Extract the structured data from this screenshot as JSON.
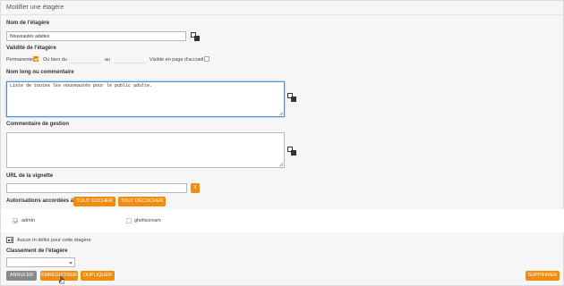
{
  "page": {
    "title": "Modifier une étagère"
  },
  "name_section": {
    "label": "Nom de l'étagère",
    "value": "Nouveautés adultes",
    "translate_icon": "translate-icon"
  },
  "validity": {
    "label": "Validité de l'étagère",
    "permanent_label": "Permanente",
    "or_from_label": "Ou bien du",
    "to_label": "au",
    "homepage_label": "Visible en page d'accueil ?"
  },
  "long_name": {
    "label": "Nom long ou commentaire",
    "value": "Liste de toutes les nouveautés pour le public adulte."
  },
  "management_comment": {
    "label": "Commentaire de gestion",
    "value": ""
  },
  "thumbnail": {
    "label": "URL de la vignette",
    "value": "",
    "clear_label": "X"
  },
  "permissions": {
    "label": "Autorisations accordées à :",
    "check_all_label": "TOUT COCHER",
    "uncheck_all_label": "TOUT DÉCOCHER",
    "users": [
      {
        "name": "admin",
        "checked": true
      },
      {
        "name": "ghellscream",
        "checked": false
      }
    ]
  },
  "tree_note": {
    "icon": "tree-icon",
    "text": "Aucun tri défini pour cette étagère"
  },
  "ranking": {
    "label": "Classement de l'étagère",
    "selected": ""
  },
  "actions": {
    "cancel": "ANNULER",
    "save": "ENREGISTRER",
    "duplicate": "DUPLIQUER",
    "delete": "SUPPRIMER"
  },
  "colors": {
    "accent": "#f28c0f",
    "grey_button": "#8a8a8a",
    "focus": "#4a90d9"
  }
}
